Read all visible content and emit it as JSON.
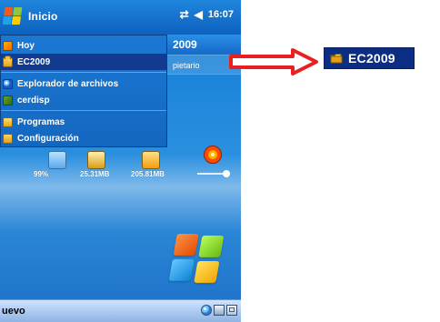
{
  "device": {
    "taskbar": {
      "title": "Inicio",
      "time": "16:07",
      "icons": [
        "windows-flag-icon",
        "connectivity-icon",
        "volume-icon"
      ]
    },
    "today_header": {
      "title": "2009",
      "owner_text": "pietario"
    },
    "start_menu": {
      "items": [
        {
          "label": "Hoy",
          "icon": "today-icon",
          "selected": false
        },
        {
          "label": "EC2009",
          "icon": "folder-icon",
          "selected": true
        },
        {
          "label": "Explorador de archivos",
          "icon": "explorer-icon",
          "selected": false
        },
        {
          "label": "cerdisp",
          "icon": "cerdisp-icon",
          "selected": false
        },
        {
          "label": "Programas",
          "icon": "programs-icon",
          "selected": false
        },
        {
          "label": "Configuración",
          "icon": "settings-icon",
          "selected": false
        }
      ]
    },
    "today_strip": {
      "battery": "99%",
      "storage_main": "25.31MB",
      "storage_card": "205.81MB"
    },
    "bottom_bar": {
      "left_softkey": "uevo"
    }
  },
  "callout": {
    "label": "EC2009",
    "arrow_color": "#ea2020",
    "label_bg": "#0b2d84",
    "icon": "folder-icon"
  },
  "colors": {
    "taskbar_blue": "#0d61bf",
    "menu_blue": "#1467bf",
    "selected_blue": "#123b8f",
    "callout_red": "#ea2020"
  }
}
